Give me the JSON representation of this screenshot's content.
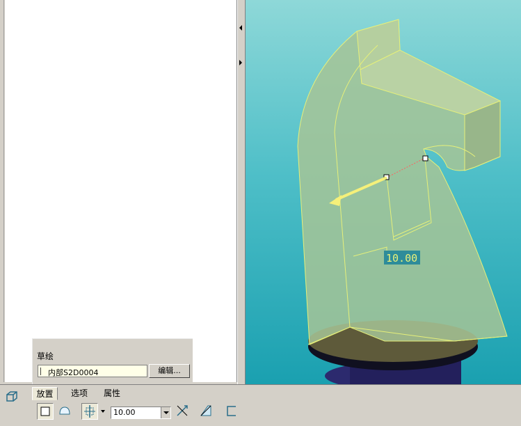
{
  "sketch_panel": {
    "label": "草绘",
    "sketch_name": "内部S2D0004",
    "edit_button": "编辑..."
  },
  "dashboard": {
    "tabs": [
      "放置",
      "选项",
      "属性"
    ],
    "depth_value": "10.00"
  },
  "viewport": {
    "dimension_label": "10.00"
  }
}
